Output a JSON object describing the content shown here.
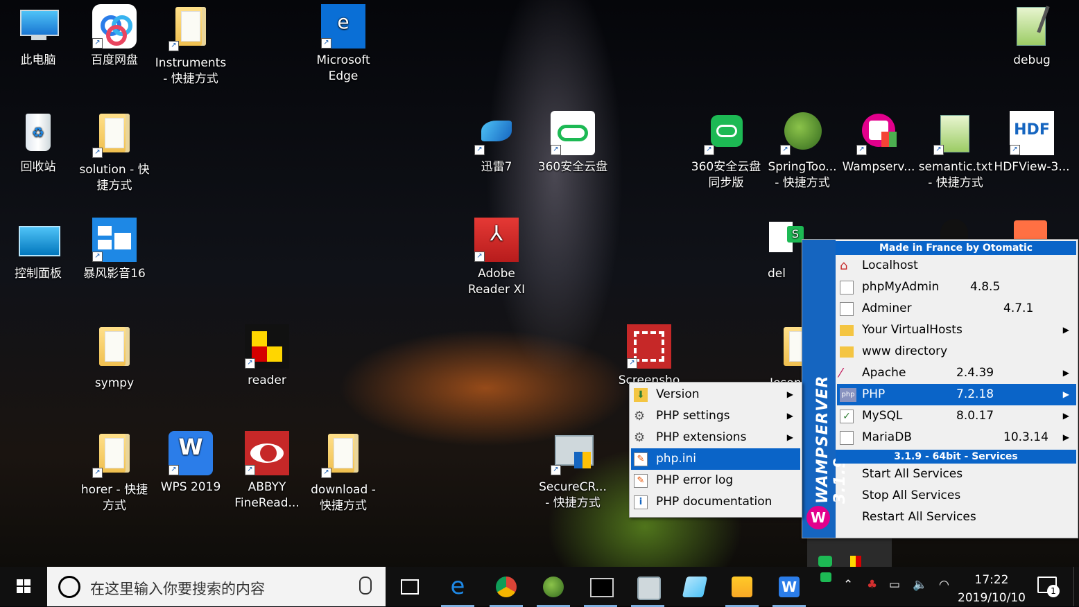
{
  "desktop_icons": [
    {
      "label": "此电脑",
      "icon": "this-pc-icon"
    },
    {
      "label": "百度网盘",
      "icon": "baidu-netdisk-icon"
    },
    {
      "label": "Instruments\n- 快捷方式",
      "icon": "folder-icon"
    },
    {
      "label": "Microsoft\nEdge",
      "icon": "edge-icon"
    },
    {
      "label": "debug",
      "icon": "notepad-plus-icon"
    },
    {
      "label": "回收站",
      "icon": "recycle-bin-icon"
    },
    {
      "label": "solution - 快\n捷方式",
      "icon": "folder-icon"
    },
    {
      "label": "迅雷7",
      "icon": "xunlei-icon"
    },
    {
      "label": "360安全云盘",
      "icon": "cloud-icon"
    },
    {
      "label": "360安全云盘\n同步版",
      "icon": "cloud-sync-icon"
    },
    {
      "label": "SpringToo...\n- 快捷方式",
      "icon": "spring-icon"
    },
    {
      "label": "Wampserv...",
      "icon": "wamp-icon"
    },
    {
      "label": "semantic.txt\n- 快捷方式",
      "icon": "notepad-plus-icon"
    },
    {
      "label": "HDFView-3...",
      "icon": "hdf-icon"
    },
    {
      "label": "控制面板",
      "icon": "control-panel-icon"
    },
    {
      "label": "暴风影音16",
      "icon": "storm-player-icon"
    },
    {
      "label": "Adobe\nReader XI",
      "icon": "adobe-reader-icon"
    },
    {
      "label": "del",
      "icon": "wps-sheet-icon"
    },
    {
      "label": "sympy",
      "icon": "folder-icon"
    },
    {
      "label": "reader",
      "icon": "reader-icon"
    },
    {
      "label": "Screensho\n-",
      "icon": "screenshot-icon"
    },
    {
      "label": "Jeson",
      "icon": "folder-icon"
    },
    {
      "label": "horer - 快捷\n方式",
      "icon": "folder-icon"
    },
    {
      "label": "WPS 2019",
      "icon": "wps-icon"
    },
    {
      "label": "ABBYY\nFineRead...",
      "icon": "abbyy-icon"
    },
    {
      "label": "download -\n快捷方式",
      "icon": "folder-icon"
    },
    {
      "label": "SecureCR...\n- 快捷方式",
      "icon": "securecrt-icon"
    }
  ],
  "wamp_menu": {
    "header": "Made in France by Otomatic",
    "side_title": "WAMPSERVER 3.1.9",
    "items": [
      {
        "label": "Localhost",
        "value": "",
        "submenu": false
      },
      {
        "label": "phpMyAdmin",
        "value": "4.8.5",
        "submenu": false
      },
      {
        "label": "Adminer",
        "value": "4.7.1",
        "submenu": false
      },
      {
        "label": "Your VirtualHosts",
        "value": "",
        "submenu": true
      },
      {
        "label": "www directory",
        "value": "",
        "submenu": false
      },
      {
        "label": "Apache",
        "value": "2.4.39",
        "submenu": true
      },
      {
        "label": "PHP",
        "value": "7.2.18",
        "submenu": true,
        "selected": true
      },
      {
        "label": "MySQL",
        "value": "8.0.17",
        "submenu": true
      },
      {
        "label": "MariaDB",
        "value": "10.3.14",
        "submenu": true
      }
    ],
    "services_header": "3.1.9 - 64bit - Services",
    "services": [
      "Start All Services",
      "Stop All Services",
      "Restart All Services"
    ]
  },
  "php_submenu": {
    "items": [
      {
        "label": "Version",
        "submenu": true
      },
      {
        "label": "PHP settings",
        "submenu": true
      },
      {
        "label": "PHP extensions",
        "submenu": true
      },
      {
        "label": "php.ini",
        "submenu": false,
        "selected": true
      },
      {
        "label": "PHP error log",
        "submenu": false
      },
      {
        "label": "PHP documentation",
        "submenu": false
      }
    ]
  },
  "taskbar": {
    "search_placeholder": "在这里输入你要搜索的内容",
    "time": "17:22",
    "date": "2019/10/10",
    "notification_count": "1",
    "apps": [
      "task-view-icon",
      "edge-icon",
      "chrome-icon",
      "spring-icon",
      "terminal-icon",
      "securecrt-icon",
      "paper-icon",
      "file-explorer-icon",
      "wps-icon"
    ]
  },
  "colors": {
    "menu_selection": "#0a64c8",
    "wamp_blue": "#1565c0",
    "taskbar": "#101010"
  }
}
